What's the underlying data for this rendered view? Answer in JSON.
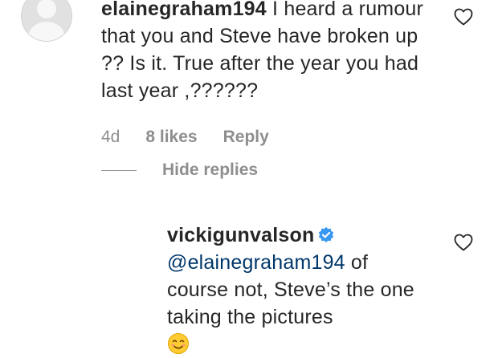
{
  "comment": {
    "username": "elainegraham194",
    "text": " I heard a rumour that you and Steve have broken up ?? Is it. True after the year you had last year ,??????",
    "time": "4d",
    "likes": "8 likes",
    "reply_label": "Reply",
    "hide_replies_label": "Hide replies"
  },
  "reply": {
    "username": "vickigunvalson",
    "mention": "@elainegraham194",
    "text": " of course not, Steve’s the one taking the pictures"
  },
  "icons": {
    "heart": "heart-icon",
    "verified": "verified-badge-icon",
    "emoji": "smiling-face-emoji",
    "avatar": "default-avatar"
  },
  "colors": {
    "text": "#262626",
    "muted": "#8e8e8e",
    "mention": "#00376b",
    "verified": "#3897f0",
    "emoji": "#ffcc33"
  }
}
